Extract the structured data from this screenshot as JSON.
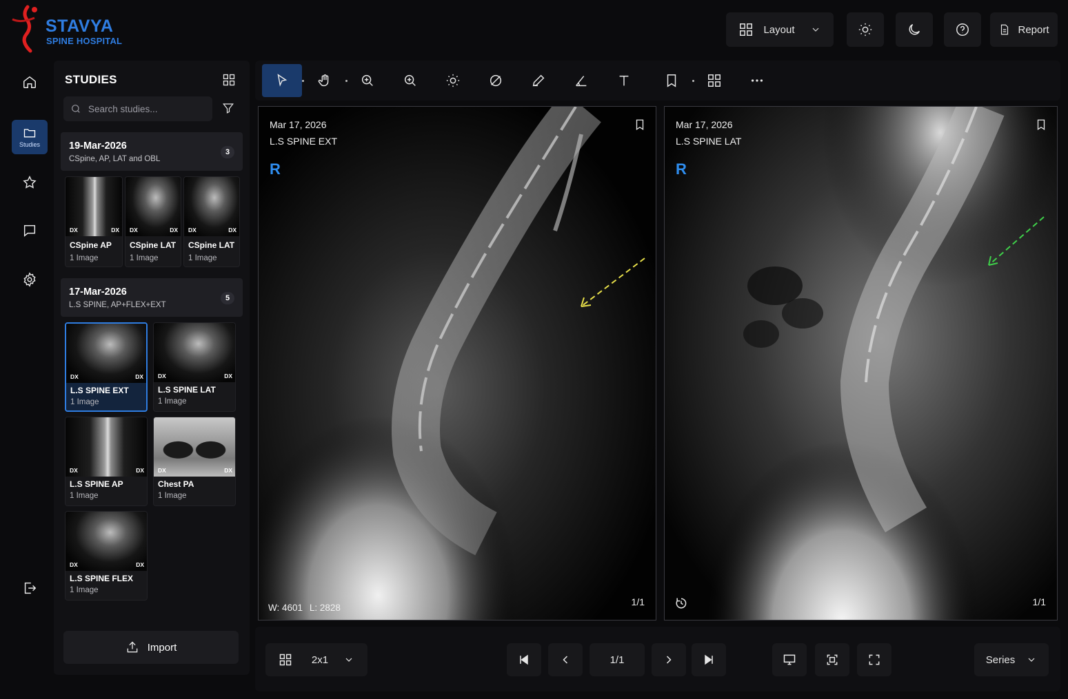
{
  "brand": {
    "name_line1": "STAVYA",
    "name_line2": "SPINE HOSPITAL",
    "logo_icon": "stavya-logo-icon",
    "accent_color": "#2f7de1"
  },
  "topbar": {
    "layout_label": "Layout",
    "report_label": "Report",
    "icons": [
      "layout-grid-icon",
      "chevron-down-icon",
      "sun-icon",
      "moon-icon",
      "help-icon",
      "document-icon"
    ]
  },
  "rail": {
    "items": [
      {
        "icon": "home-icon",
        "label": ""
      },
      {
        "icon": "folder-icon",
        "label": "Studies",
        "active": true
      },
      {
        "icon": "star-icon",
        "label": ""
      },
      {
        "icon": "chat-icon",
        "label": ""
      },
      {
        "icon": "gear-icon",
        "label": ""
      },
      {
        "icon": "logout-icon",
        "label": ""
      }
    ]
  },
  "studies": {
    "title": "STUDIES",
    "search_placeholder": "Search studies...",
    "import_label": "Import",
    "groups": [
      {
        "date": "19-Mar-2026",
        "description": "CSpine, AP, LAT and OBL",
        "count": "3",
        "series": [
          {
            "name": "CSpine AP",
            "images": "1 Image",
            "modality": "DX"
          },
          {
            "name": "CSpine LAT",
            "images": "1 Image",
            "modality": "DX"
          },
          {
            "name": "CSpine LAT",
            "images": "1 Image",
            "modality": "DX"
          }
        ]
      },
      {
        "date": "17-Mar-2026",
        "description": "L.S SPINE, AP+FLEX+EXT",
        "count": "5",
        "series": [
          {
            "name": "L.S SPINE EXT",
            "images": "1 Image",
            "modality": "DX",
            "active": true
          },
          {
            "name": "L.S SPINE LAT",
            "images": "1 Image",
            "modality": "DX"
          },
          {
            "name": "L.S SPINE AP",
            "images": "1 Image",
            "modality": "DX"
          },
          {
            "name": "Chest PA",
            "images": "1 Image",
            "modality": "DX"
          },
          {
            "name": "L.S SPINE FLEX",
            "images": "1 Image",
            "modality": "DX"
          }
        ]
      }
    ]
  },
  "toolbar": {
    "tools": [
      "pointer-icon",
      "pan-hand-icon",
      "zoom-icon",
      "magnify-icon",
      "brightness-icon",
      "invert-icon",
      "pencil-icon",
      "angle-icon",
      "text-icon",
      "bookmark-icon",
      "grid-icon",
      "more-icon"
    ],
    "active": "pointer-icon"
  },
  "viewports": [
    {
      "date": "Mar 17, 2026",
      "series": "L.S SPINE EXT",
      "orientation": "R",
      "frame": "1/1",
      "window_width": "W: 4601",
      "window_level": "L: 2828",
      "arrow_color": "#e8e04a"
    },
    {
      "date": "Mar 17, 2026",
      "series": "L.S SPINE LAT",
      "orientation": "R",
      "frame": "1/1",
      "arrow_color": "#3fd14a"
    }
  ],
  "bottombar": {
    "layout_value": "2x1",
    "page": "1/1",
    "series_label": "Series"
  }
}
